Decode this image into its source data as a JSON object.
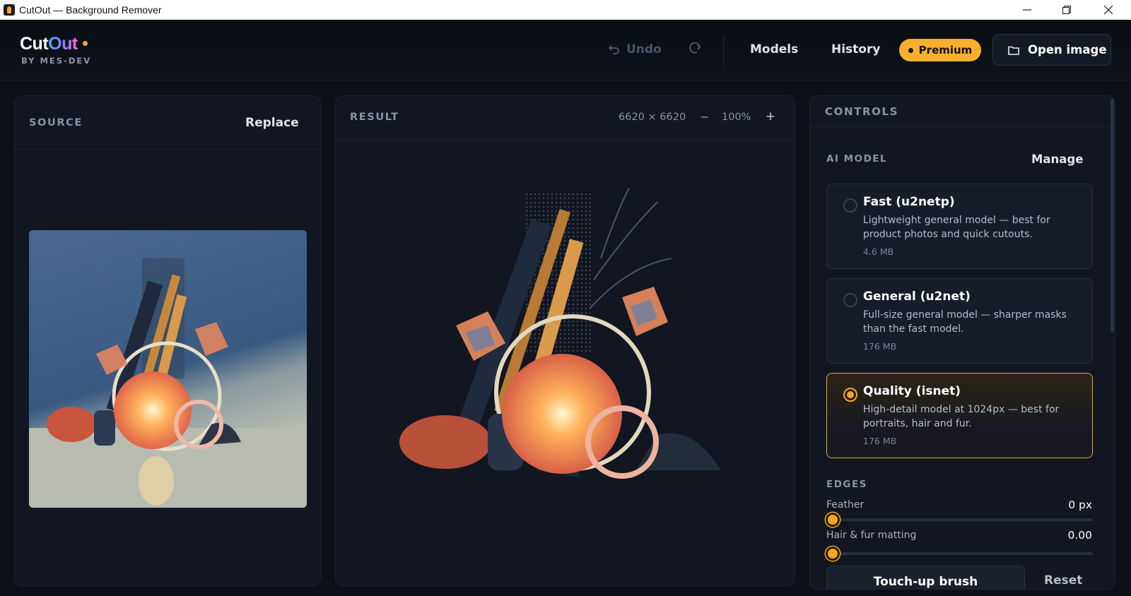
{
  "window": {
    "title": "CutOut — Background Remover"
  },
  "brand": {
    "word_a": "Cut",
    "word_b": "Out",
    "byline": "BY MES-DEV"
  },
  "toolbar": {
    "undo_label": "Undo",
    "models_label": "Models",
    "history_label": "History",
    "premium_label": "Premium",
    "open_label": "Open image"
  },
  "source": {
    "title": "SOURCE",
    "replace_label": "Replace"
  },
  "result": {
    "title": "RESULT",
    "dimensions": "6620 × 6620",
    "zoom_out": "−",
    "zoom": "100%",
    "zoom_in": "+"
  },
  "controls": {
    "title": "CONTROLS",
    "ai_model_label": "AI MODEL",
    "manage_label": "Manage",
    "models": [
      {
        "name": "Fast (u2netp)",
        "desc": "Lightweight general model — best for product photos and quick cutouts.",
        "size": "4.6 MB",
        "selected": false
      },
      {
        "name": "General (u2net)",
        "desc": "Full-size general model — sharper masks than the fast model.",
        "size": "176 MB",
        "selected": false
      },
      {
        "name": "Quality (isnet)",
        "desc": "High-detail model at 1024px — best for portraits, hair and fur.",
        "size": "176 MB",
        "selected": true
      }
    ],
    "edges_label": "EDGES",
    "feather": {
      "label": "Feather",
      "value": "0 px",
      "fraction": 0
    },
    "matting": {
      "label": "Hair & fur matting",
      "value": "0.00",
      "fraction": 0
    },
    "touchup_label": "Touch-up brush",
    "reset_label": "Reset"
  },
  "colors": {
    "accent": "#f5a623",
    "background": "#0c1018",
    "panel": "#111621"
  }
}
